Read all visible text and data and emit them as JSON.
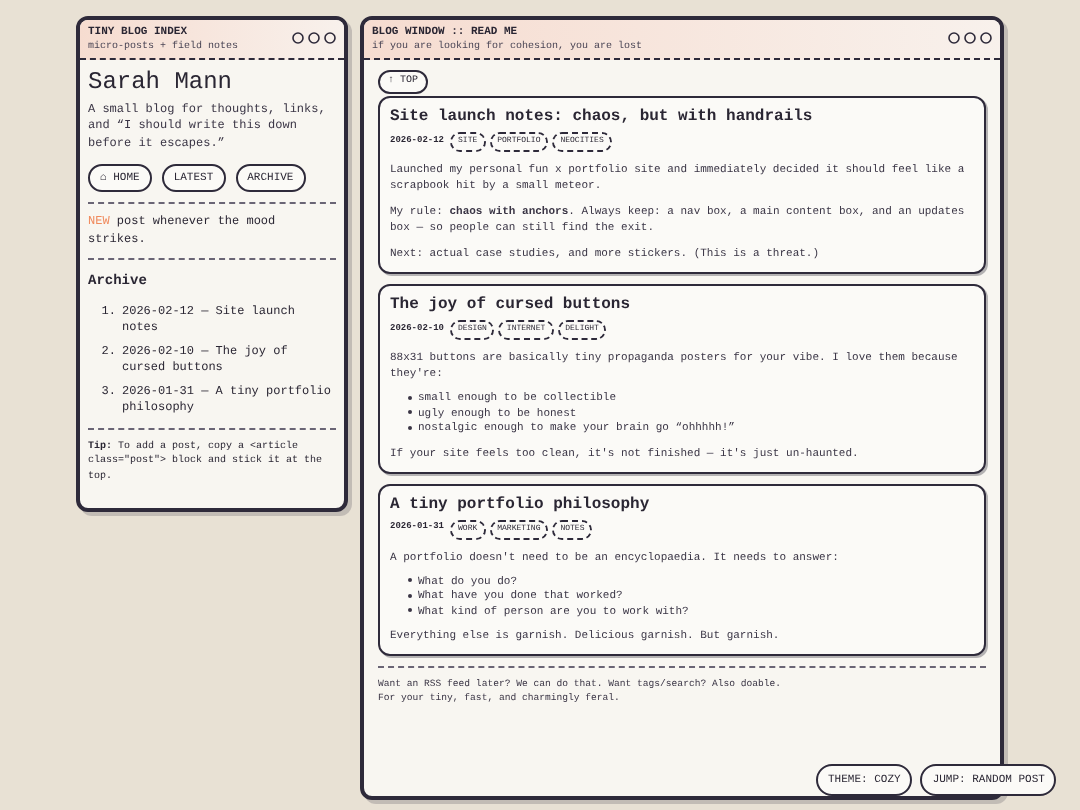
{
  "sidebar": {
    "title": "TINY BLOG INDEX",
    "subtitle": "micro-posts + field notes",
    "name": "Sarah Mann",
    "intro": "A small blog for thoughts, links, and “I should write this down before it escapes.”",
    "nav": [
      {
        "label": "⌂ HOME"
      },
      {
        "label": "LATEST"
      },
      {
        "label": "ARCHIVE"
      }
    ],
    "update": {
      "badge": "NEW",
      "text": "post whenever the mood strikes."
    },
    "archive_heading": "Archive",
    "archive": [
      {
        "number": "1.",
        "text": "2026-02-12 — Site launch notes"
      },
      {
        "number": "2.",
        "text": "2026-02-10 — The joy of cursed buttons"
      },
      {
        "number": "3.",
        "text": "2026-01-31 — A tiny portfolio philosophy"
      }
    ],
    "tip": "**Tip:** To add a post, copy a <article class=\"post\"> block and stick it at the top."
  },
  "main": {
    "title": "BLOG WINDOW :: READ ME",
    "subtitle": "if you are looking for cohesion, you are lost",
    "top_button": "↑ TOP",
    "posts": [
      {
        "title": "Site launch notes: chaos, but with handrails",
        "date": "2026-02-12",
        "tags": [
          "SITE",
          "PORTFOLIO",
          "NEOCITIES"
        ],
        "blocks": [
          {
            "kind": "p",
            "text": "Launched my personal fun x portfolio site and immediately decided it should feel like a scrapbook hit by a small meteor."
          },
          {
            "kind": "p",
            "text": "My rule: **chaos with anchors**. Always keep: a nav box, a main content box, and an updates box — so people can still find the exit."
          },
          {
            "kind": "p",
            "text": "Next: actual case studies, and more stickers. (This is a threat.)"
          }
        ]
      },
      {
        "title": "The joy of cursed buttons",
        "date": "2026-02-10",
        "tags": [
          "DESIGN",
          "INTERNET",
          "DELIGHT"
        ],
        "blocks": [
          {
            "kind": "p",
            "text": "88x31 buttons are basically tiny propaganda posters for your vibe. I love them because they're:"
          },
          {
            "kind": "list",
            "items": [
              "small enough to be collectible",
              "ugly enough to be honest",
              "nostalgic enough to make your brain go “ohhhhh!”"
            ]
          },
          {
            "kind": "p",
            "text": "If your site feels too clean, it's not finished — it's just un-haunted."
          }
        ]
      },
      {
        "title": "A tiny portfolio philosophy",
        "date": "2026-01-31",
        "tags": [
          "WORK",
          "MARKETING",
          "NOTES"
        ],
        "blocks": [
          {
            "kind": "p",
            "text": "A portfolio doesn't need to be an encyclopaedia. It needs to answer:"
          },
          {
            "kind": "list",
            "items": [
              "What do you do?",
              "What have you done that worked?",
              "What kind of person are you to work with?"
            ]
          },
          {
            "kind": "p",
            "text": "Everything else is garnish. Delicious garnish. But garnish."
          }
        ]
      }
    ],
    "footer": "Want an RSS feed later? We can do that. Want tags/search? Also doable. For your tiny, fast, and charmingly feral."
  },
  "floating_buttons": [
    {
      "label": "THEME: COZY"
    },
    {
      "label": "JUMP: RANDOM POST"
    }
  ]
}
